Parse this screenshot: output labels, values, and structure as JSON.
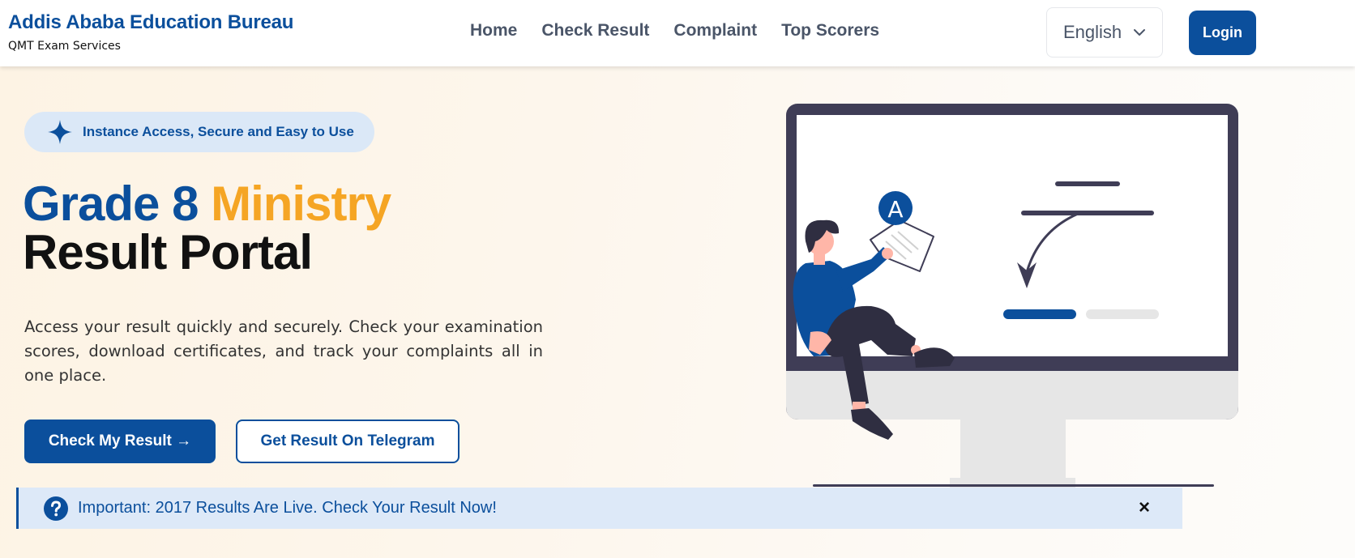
{
  "brand": {
    "title": "Addis Ababa Education Bureau",
    "subtitle": "QMT Exam Services"
  },
  "nav": {
    "links": [
      "Home",
      "Check Result",
      "Complaint",
      "Top Scorers"
    ],
    "language": "English",
    "login_label": "Login"
  },
  "hero": {
    "badge": "Instance Access, Secure and Easy to Use",
    "title_part1": "Grade 8",
    "title_part2": "Ministry",
    "title_line2": "Result Portal",
    "description": "Access your result quickly and securely. Check your examination scores, download certificates, and track your complaints all in one place.",
    "primary_button": "Check My Result →",
    "secondary_button": "Get Result On Telegram"
  },
  "illustration": {
    "grade_letter": "A"
  },
  "alert": {
    "text": "Important: 2017 Results Are Live. Check Your Result Now!",
    "close": "×"
  },
  "colors": {
    "primary": "#0b4f9c",
    "accent": "#f5a524",
    "text_dark": "#111111",
    "nav_text": "#4a5568",
    "alert_bg": "#dde9f8",
    "badge_bg": "#dbe8f7"
  },
  "icons": {
    "badge": "sparkle-icon",
    "language": "chevron-down-icon",
    "alert": "question-circle-icon",
    "close": "close-icon"
  }
}
